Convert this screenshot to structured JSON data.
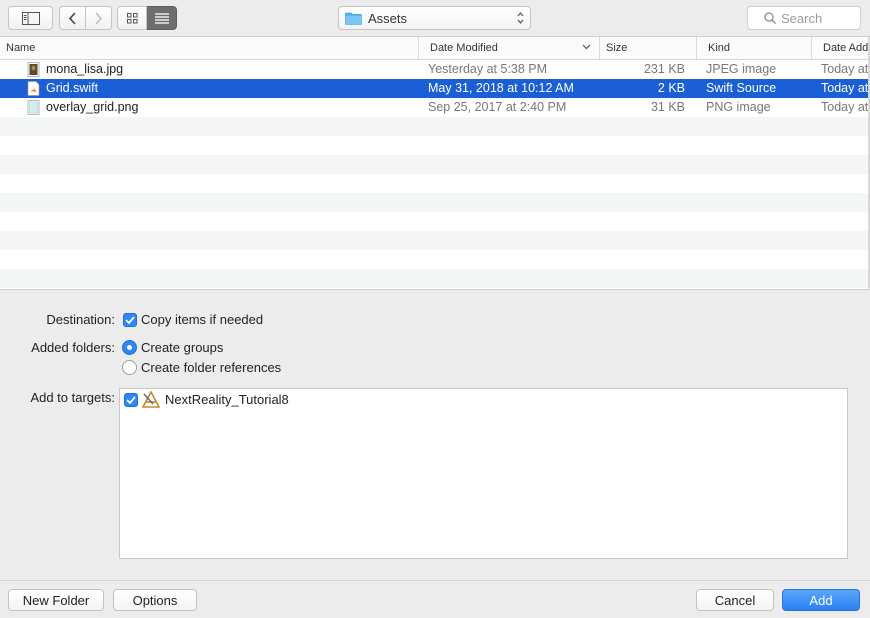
{
  "toolbar": {
    "location": "Assets",
    "search_placeholder": "Search"
  },
  "columns": {
    "name": "Name",
    "date_modified": "Date Modified",
    "size": "Size",
    "kind": "Kind",
    "date_added": "Date Add"
  },
  "files": [
    {
      "name": "mona_lisa.jpg",
      "date_modified": "Yesterday at 5:38 PM",
      "size": "231 KB",
      "kind": "JPEG image",
      "date_added": "Today at",
      "icon": "jpeg-file-icon",
      "selected": false
    },
    {
      "name": "Grid.swift",
      "date_modified": "May 31, 2018 at 10:12 AM",
      "size": "2 KB",
      "kind": "Swift Source",
      "date_added": "Today at",
      "icon": "swift-file-icon",
      "selected": true
    },
    {
      "name": "overlay_grid.png",
      "date_modified": "Sep 25, 2017 at 2:40 PM",
      "size": "31 KB",
      "kind": "PNG image",
      "date_added": "Today at",
      "icon": "png-file-icon",
      "selected": false
    }
  ],
  "options": {
    "destination_label": "Destination:",
    "copy_items_label": "Copy items if needed",
    "copy_items_checked": true,
    "added_folders_label": "Added folders:",
    "create_groups_label": "Create groups",
    "create_folder_refs_label": "Create folder references",
    "selected_folder_option": "Create groups",
    "targets_label": "Add to targets:",
    "targets": [
      {
        "name": "NextReality_Tutorial8",
        "checked": true,
        "icon": "xcode-app-icon"
      }
    ]
  },
  "footer": {
    "new_folder": "New Folder",
    "options": "Options",
    "cancel": "Cancel",
    "add": "Add"
  },
  "colors": {
    "accent": "#2f86f5",
    "selection": "#1a5fd6",
    "window_bg": "#ececec"
  }
}
